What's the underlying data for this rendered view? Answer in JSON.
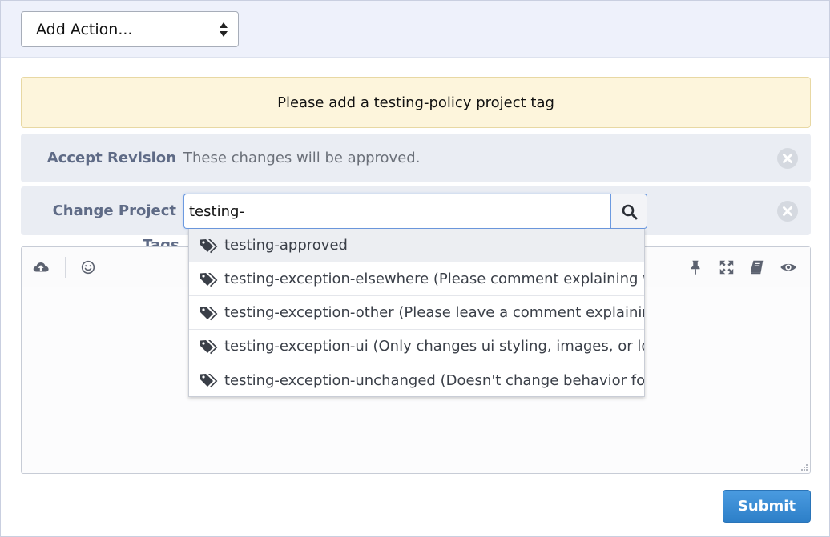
{
  "action_select": {
    "label": "Add Action..."
  },
  "warning": {
    "text": "Please add a testing-policy project tag"
  },
  "accept_revision": {
    "label": "Accept Revision",
    "description": "These changes will be approved."
  },
  "change_project": {
    "label": "Change Project",
    "sublabel": "Tags",
    "input_value": "testing-"
  },
  "suggestions": [
    "testing-approved",
    "testing-exception-elsewhere (Please comment explaining whe",
    "testing-exception-other (Please leave a comment explaining v",
    "testing-exception-ui (Only changes ui styling, images, or local",
    "testing-exception-unchanged (Doesn't change behavior for u"
  ],
  "toolbar_icons": [
    "upload-icon",
    "emoji-icon",
    "pin-icon",
    "fullscreen-icon",
    "book-icon",
    "eye-icon"
  ],
  "submit": {
    "label": "Submit"
  },
  "colors": {
    "accent": "#3a8dd6",
    "warning_bg": "#fdf5dc",
    "row_bg": "#eaedf3",
    "label": "#5f6b86"
  }
}
